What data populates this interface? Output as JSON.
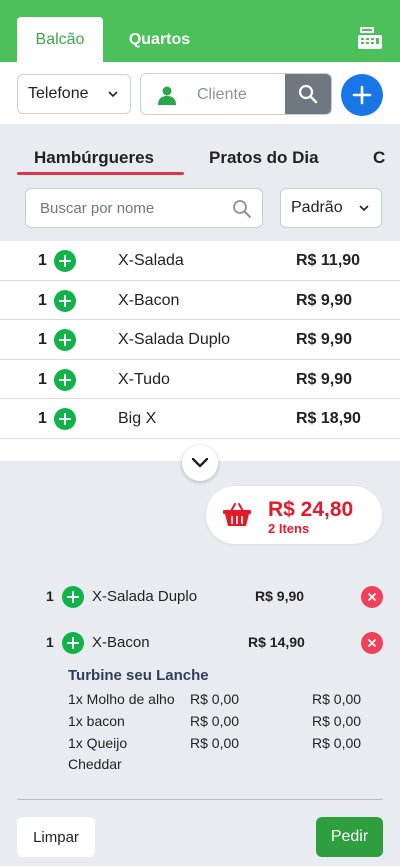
{
  "header": {
    "tabs": [
      {
        "label": "Balcão",
        "active": true
      },
      {
        "label": "Quartos",
        "active": false
      }
    ],
    "register_icon": "cash-register-icon"
  },
  "filters": {
    "channel_select": "Telefone",
    "client_placeholder": "Cliente"
  },
  "categories": [
    "Hambúrgueres",
    "Pratos do Dia",
    "C"
  ],
  "active_category": "Hambúrgueres",
  "search": {
    "placeholder": "Buscar por nome",
    "sort_select": "Padrão"
  },
  "products": [
    {
      "qty": "1",
      "name": "X-Salada",
      "price": "R$ 11,90"
    },
    {
      "qty": "1",
      "name": "X-Bacon",
      "price": "R$ 9,90"
    },
    {
      "qty": "1",
      "name": "X-Salada Duplo",
      "price": "R$ 9,90"
    },
    {
      "qty": "1",
      "name": "X-Tudo",
      "price": "R$ 9,90"
    },
    {
      "qty": "1",
      "name": "Big X",
      "price": "R$ 18,90"
    }
  ],
  "cart": {
    "total": "R$ 24,80",
    "count": "2 Itens"
  },
  "order_items": [
    {
      "qty": "1",
      "name": "X-Salada Duplo",
      "price": "R$ 9,90"
    },
    {
      "qty": "1",
      "name": "X-Bacon",
      "price": "R$ 14,90"
    }
  ],
  "extras": {
    "title": "Turbine seu Lanche",
    "items": [
      {
        "name": "1x Molho de alho",
        "unit_price": "R$ 0,00",
        "total": "R$ 0,00"
      },
      {
        "name": "1x bacon",
        "unit_price": "R$ 0,00",
        "total": "R$ 0,00"
      },
      {
        "name": "1x Queijo",
        "name2": "Cheddar",
        "unit_price": "R$ 0,00",
        "total": "R$ 0,00"
      }
    ]
  },
  "actions": {
    "clear": "Limpar",
    "order": "Pedir"
  },
  "colors": {
    "header_green": "#4cc05a",
    "add_blue": "#1976e6",
    "accent_red": "#e21a2a",
    "plus_green": "#12b24a",
    "order_green": "#2e9e3e"
  }
}
